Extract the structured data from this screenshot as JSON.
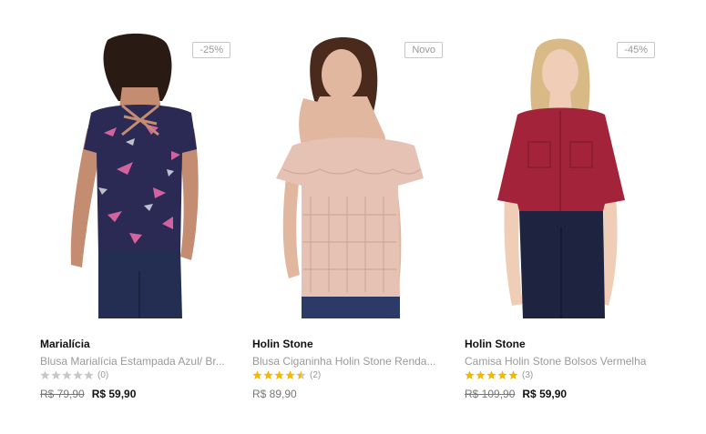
{
  "products": [
    {
      "badge": "-25%",
      "brand": "Marialícia",
      "title": "Blusa Marialícia Estampada Azul/ Br...",
      "rating_count": "(0)",
      "rating": 0,
      "price_old": "R$ 79,90",
      "price_new": "R$ 59,90"
    },
    {
      "badge": "Novo",
      "brand": "Holin Stone",
      "title": "Blusa Ciganinha Holin Stone Renda...",
      "rating_count": "(2)",
      "rating": 4.5,
      "price": "R$ 89,90"
    },
    {
      "badge": "-45%",
      "brand": "Holin Stone",
      "title": "Camisa Holin Stone Bolsos Vermelha",
      "rating_count": "(3)",
      "rating": 5,
      "price_old": "R$ 109,90",
      "price_new": "R$ 59,90"
    }
  ],
  "colors": {
    "star_filled": "#f5b800",
    "star_empty": "#c8c8c8",
    "top1_print": "#2b2a55",
    "top2_lace": "#e6c2b4",
    "top3_red": "#a3243a",
    "jeans": "#232e52"
  }
}
